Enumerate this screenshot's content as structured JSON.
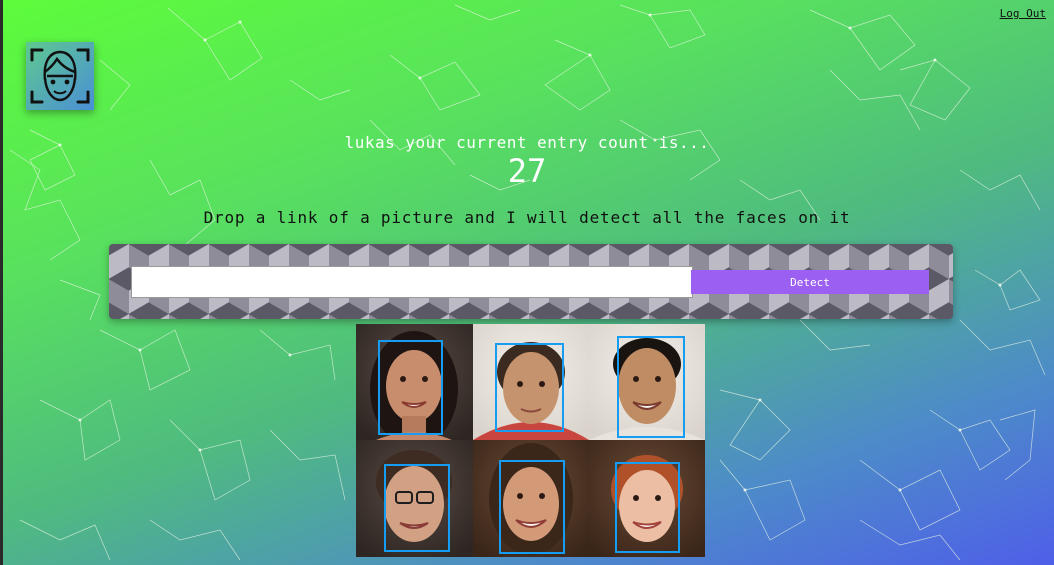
{
  "header": {
    "logout_label": "Log Out"
  },
  "logo": {
    "icon": "face-scan-icon"
  },
  "user": {
    "welcome_text": "lukas your current entry count is...",
    "entry_count": "27"
  },
  "instructions": {
    "text": "Drop a link of a picture and I will detect all the faces on it"
  },
  "form": {
    "url_value": "",
    "url_placeholder": "",
    "detect_label": "Detect"
  },
  "result": {
    "faces_detected": 6,
    "box_color": "#149df2",
    "faces": [
      {
        "row": 1,
        "col": 1
      },
      {
        "row": 1,
        "col": 2
      },
      {
        "row": 1,
        "col": 3
      },
      {
        "row": 2,
        "col": 1
      },
      {
        "row": 2,
        "col": 2
      },
      {
        "row": 2,
        "col": 3
      }
    ]
  },
  "colors": {
    "bg_start": "#5dfc3b",
    "bg_end": "#4e5fe8",
    "button": "#9b5ff2",
    "text_light": "#ffffff",
    "text_dark": "#111111"
  }
}
